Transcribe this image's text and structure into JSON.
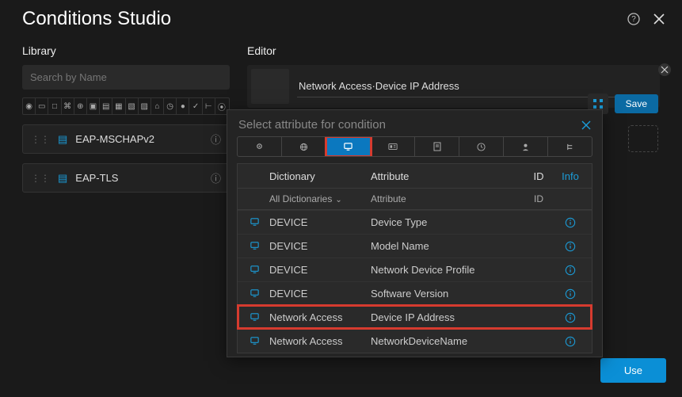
{
  "header": {
    "title": "Conditions Studio"
  },
  "library": {
    "title": "Library",
    "search_placeholder": "Search by Name",
    "items": [
      {
        "label": "EAP-MSCHAPv2"
      },
      {
        "label": "EAP-TLS"
      }
    ]
  },
  "editor": {
    "title": "Editor",
    "breadcrumb": "Network Access·Device IP Address",
    "save_label": "Save"
  },
  "popover": {
    "title": "Select attribute for condition",
    "columns": {
      "dictionary": "Dictionary",
      "attribute": "Attribute",
      "id": "ID",
      "info": "Info"
    },
    "filters": {
      "dictionary": "All Dictionaries",
      "attribute": "Attribute",
      "id": "ID"
    },
    "rows": [
      {
        "dict": "DEVICE",
        "attr": "Device Type"
      },
      {
        "dict": "DEVICE",
        "attr": "Model Name"
      },
      {
        "dict": "DEVICE",
        "attr": "Network Device Profile"
      },
      {
        "dict": "DEVICE",
        "attr": "Software Version"
      },
      {
        "dict": "Network Access",
        "attr": "Device IP Address",
        "highlight": true
      },
      {
        "dict": "Network Access",
        "attr": "NetworkDeviceName"
      }
    ]
  },
  "footer": {
    "use_label": "Use"
  }
}
